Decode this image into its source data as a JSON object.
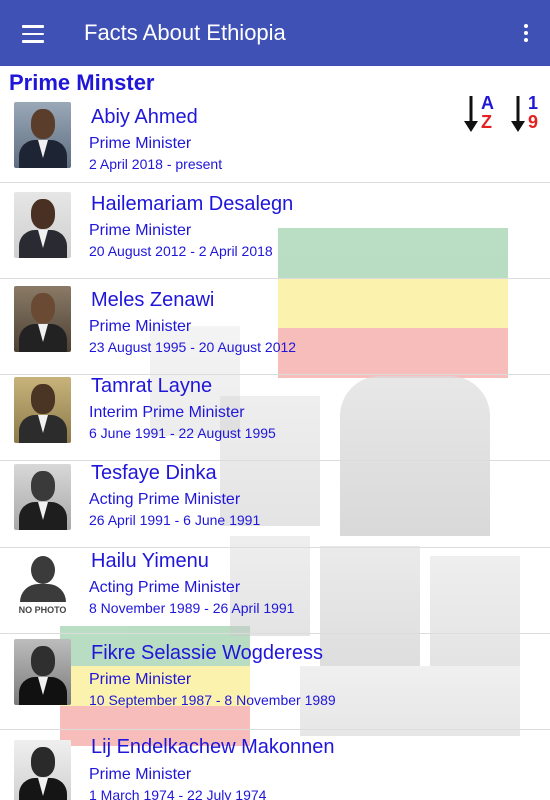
{
  "appbar": {
    "title": "Facts About Ethiopia",
    "menu_icon": "hamburger-menu-icon",
    "overflow_icon": "more-vert-icon",
    "color": "#3f51b5"
  },
  "section": {
    "title": "Prime Minster"
  },
  "sort": {
    "az_top": "A",
    "az_bottom": "Z",
    "num_top": "1",
    "num_bottom": "9",
    "arrow_icon": "arrow-down-icon"
  },
  "colors": {
    "text_blue": "#1f16d9",
    "accent_red": "#e52020"
  },
  "prime_ministers": [
    {
      "name": "Abiy Ahmed",
      "role": "Prime Minister",
      "term": "2 April 2018 - present"
    },
    {
      "name": "Hailemariam Desalegn",
      "role": "Prime Minister",
      "term": "20 August 2012 - 2 April 2018"
    },
    {
      "name": "Meles Zenawi",
      "role": "Prime Minister",
      "term": "23 August 1995 - 20 August 2012"
    },
    {
      "name": "Tamrat Layne",
      "role": "Interim Prime Minister",
      "term": "6 June 1991 - 22 August 1995"
    },
    {
      "name": "Tesfaye Dinka",
      "role": "Acting Prime Minister",
      "term": "26 April 1991 - 6 June 1991"
    },
    {
      "name": "Hailu Yimenu",
      "role": "Acting Prime Minister",
      "term": "8 November 1989 - 26 April 1991",
      "photo_label": "NO PHOTO"
    },
    {
      "name": "Fikre Selassie Wogderess",
      "role": "Prime Minister",
      "term": "10 September 1987 - 8 November 1989"
    },
    {
      "name": "Lij Endelkachew Makonnen",
      "role": "Prime Minister",
      "term": "1 March 1974 - 22 July 1974"
    }
  ]
}
